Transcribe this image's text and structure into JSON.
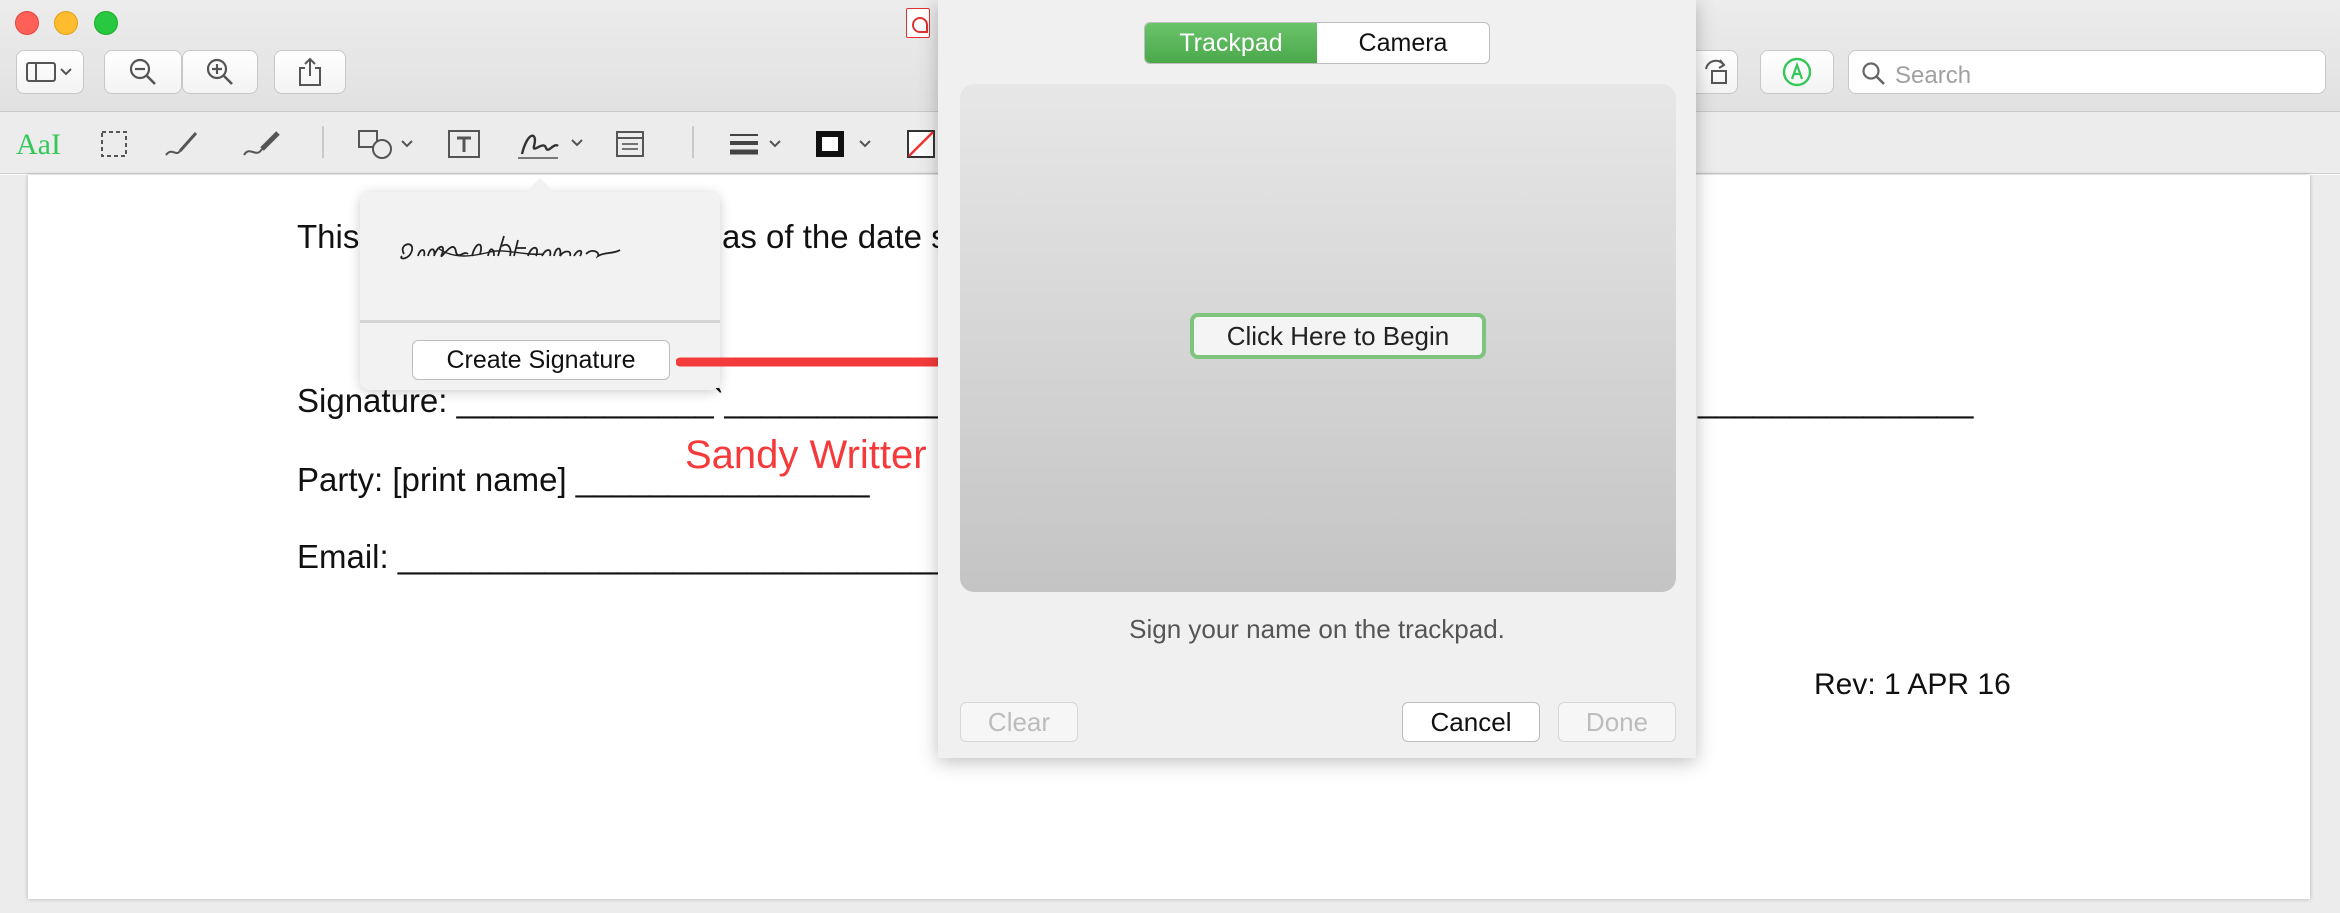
{
  "toolbar": {
    "search_placeholder": "Search"
  },
  "markup": {
    "text_style_label": "AaI"
  },
  "document": {
    "line_intro": "This",
    "line_intro_rest": "as of the date s",
    "signature_line": "Signature: ______________ˋ____________",
    "signature_line_right": "_______________",
    "party_line": "Party: [print name] ________________",
    "email_line": "Email: ______________________________",
    "revision": "Rev: 1 APR 16"
  },
  "signature_popover": {
    "saved_signature_text": "Sandy Writter",
    "create_button": "Create Signature"
  },
  "annotation": {
    "name_text": "Sandy Writter",
    "color": "#f43a3a"
  },
  "signature_panel": {
    "tabs": [
      {
        "label": "Trackpad",
        "active": true
      },
      {
        "label": "Camera",
        "active": false
      }
    ],
    "begin_button": "Click Here to Begin",
    "hint": "Sign your name on the trackpad.",
    "clear_button": "Clear",
    "cancel_button": "Cancel",
    "done_button": "Done"
  },
  "colors": {
    "accent_green": "#4aa84a",
    "markup_green": "#34c759"
  }
}
